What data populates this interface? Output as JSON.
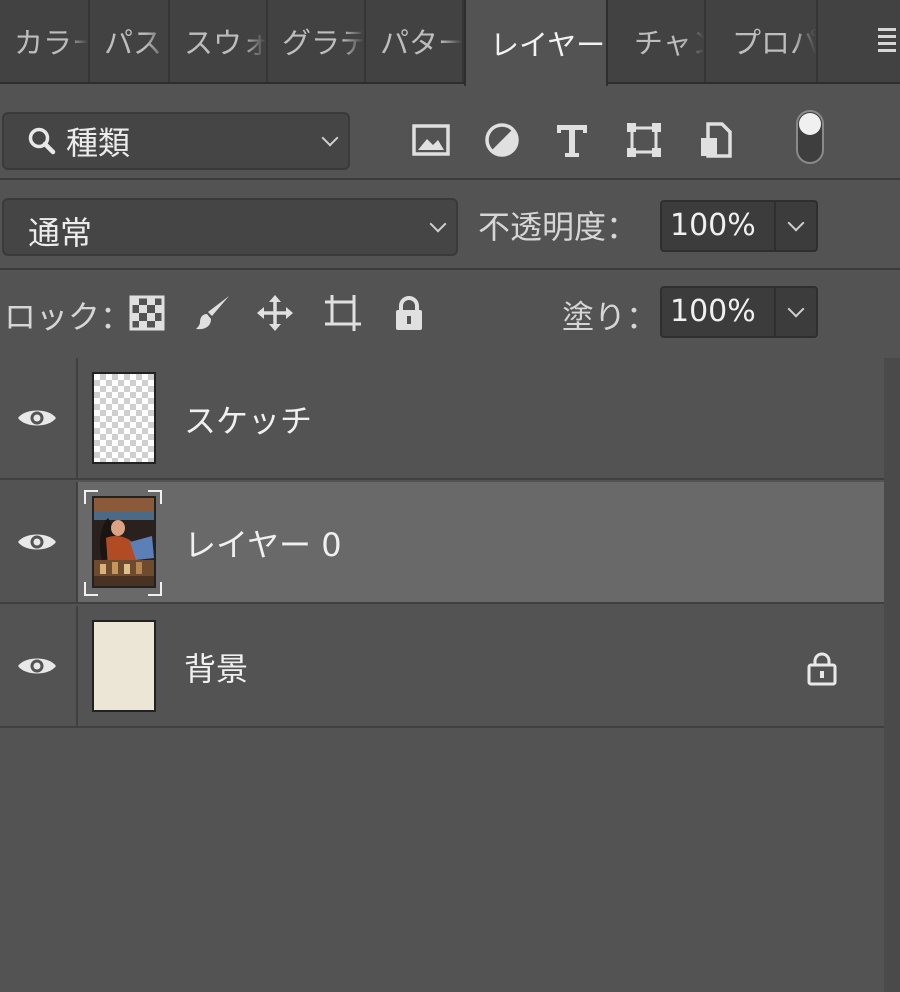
{
  "tabs": [
    {
      "label": "カラー",
      "active": false
    },
    {
      "label": "パス",
      "active": false
    },
    {
      "label": "スウォッチ",
      "active": false
    },
    {
      "label": "グラデーション",
      "active": false
    },
    {
      "label": "パターン",
      "active": false
    },
    {
      "label": "レイヤー",
      "active": true
    },
    {
      "label": "チャンネル",
      "active": false
    },
    {
      "label": "プロパティ",
      "active": false
    }
  ],
  "filter": {
    "kind_label": "種類",
    "icons": [
      "image-filter-icon",
      "adjustment-filter-icon",
      "type-filter-icon",
      "shape-filter-icon",
      "smart-object-filter-icon"
    ]
  },
  "blend": {
    "mode": "通常",
    "opacity_label": "不透明度：",
    "opacity_value": "100%"
  },
  "lock": {
    "label": "ロック：",
    "fill_label": "塗り：",
    "fill_value": "100%"
  },
  "layers": [
    {
      "name": "スケッチ",
      "thumb": "transparent",
      "selected": false,
      "locked": false
    },
    {
      "name": "レイヤー 0",
      "thumb": "photo",
      "selected": true,
      "locked": false
    },
    {
      "name": "背景",
      "thumb": "beige",
      "selected": false,
      "locked": true
    }
  ],
  "colors": {
    "panel": "#535353",
    "tabbar": "#424242",
    "selected_row": "#696969",
    "background_thumb": "#ebe6d6"
  }
}
